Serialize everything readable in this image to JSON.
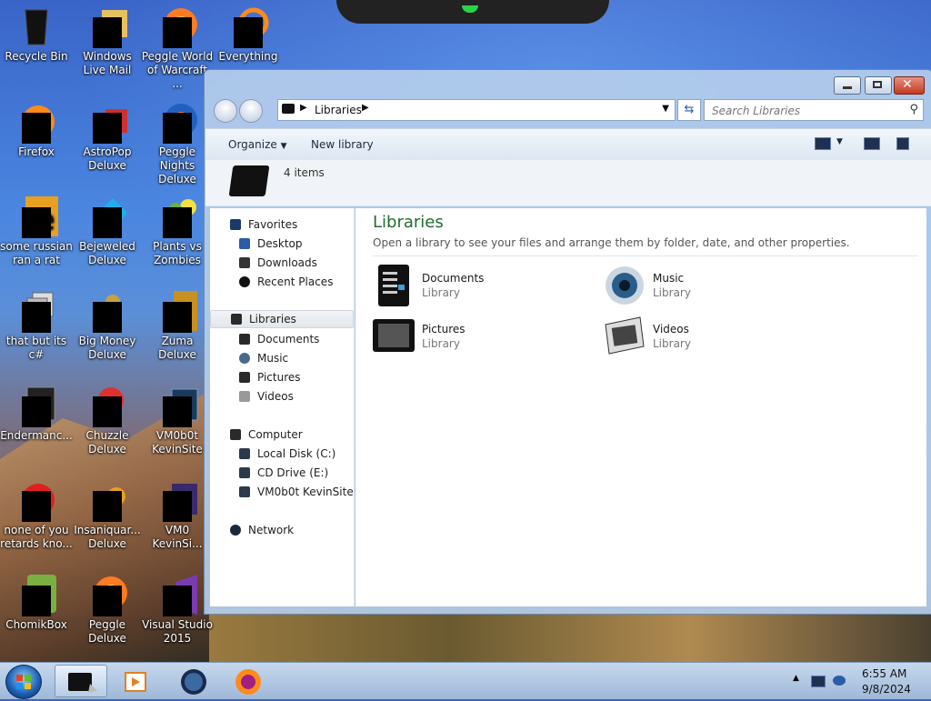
{
  "desktop": {
    "icons": [
      {
        "label": "Recycle Bin"
      },
      {
        "label": "Windows Live Mail"
      },
      {
        "label": "Peggle World of Warcraft ..."
      },
      {
        "label": "Everything"
      },
      {
        "label": "Firefox"
      },
      {
        "label": "AstroPop Deluxe"
      },
      {
        "label": "Peggle Nights Deluxe"
      },
      {
        "label": "some russian ran a rat"
      },
      {
        "label": "Bejeweled Deluxe"
      },
      {
        "label": "Plants vs Zombies"
      },
      {
        "label": "that but its c#"
      },
      {
        "label": "Big Money Deluxe"
      },
      {
        "label": "Zuma Deluxe"
      },
      {
        "label": "Endermanc..."
      },
      {
        "label": "Chuzzle Deluxe"
      },
      {
        "label": "VM0b0t KevinSite"
      },
      {
        "label": "none of you retards kno..."
      },
      {
        "label": "Insaniquar... Deluxe"
      },
      {
        "label": "VM0 KevinSi..."
      },
      {
        "label": "ChomikBox"
      },
      {
        "label": "Peggle Deluxe"
      },
      {
        "label": "Visual Studio 2015"
      }
    ]
  },
  "explorer": {
    "address": {
      "crumb": "Libraries"
    },
    "search": {
      "placeholder": "Search Libraries"
    },
    "toolbar": {
      "organize": "Organize",
      "new_library": "New library"
    },
    "details": {
      "count": "4 items"
    },
    "nav": {
      "favorites": "Favorites",
      "desktop": "Desktop",
      "downloads": "Downloads",
      "recent": "Recent Places",
      "libraries": "Libraries",
      "documents": "Documents",
      "music": "Music",
      "pictures": "Pictures",
      "videos": "Videos",
      "computer": "Computer",
      "local_disk": "Local Disk (C:)",
      "cd_drive": "CD Drive (E:)",
      "vm": "VM0b0t KevinSite",
      "network": "Network"
    },
    "content": {
      "heading": "Libraries",
      "description": "Open a library to see your files and arrange them by folder, date, and other properties.",
      "items": [
        {
          "name": "Documents",
          "type": "Library",
          "icon": "documents-library-icon"
        },
        {
          "name": "Music",
          "type": "Library",
          "icon": "music-library-icon"
        },
        {
          "name": "Pictures",
          "type": "Library",
          "icon": "pictures-library-icon"
        },
        {
          "name": "Videos",
          "type": "Library",
          "icon": "videos-library-icon"
        }
      ]
    }
  },
  "taskbar": {
    "clock": {
      "time": "6:55 AM",
      "date": "9/8/2024"
    }
  }
}
